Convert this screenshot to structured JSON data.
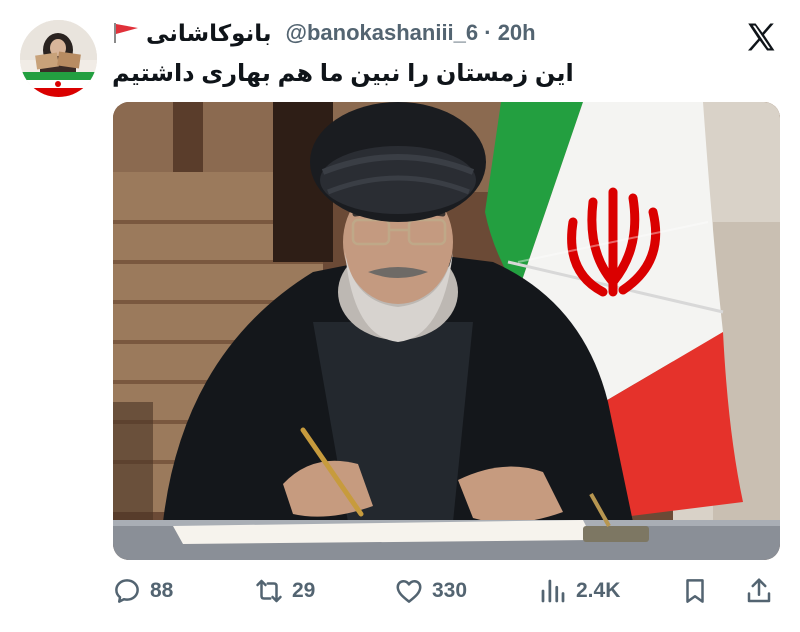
{
  "tweet": {
    "author": {
      "display_name": "بانوکاشانی",
      "handle_time": "@banokashaniii_6 · 20h",
      "avatar_icon": "avatar-with-iran-flag",
      "name_emoji": "iran-flag-emoji"
    },
    "text": "این زمستان را نبین ما هم بهاری داشتیم",
    "platform_icon": "x-logo-icon",
    "media": {
      "kind": "photo",
      "icon": "photo-cleric-signing-with-iran-flag"
    },
    "actions": {
      "replies": "88",
      "retweets": "29",
      "likes": "330",
      "views": "2.4K"
    }
  },
  "colors": {
    "text_primary": "#0f1419",
    "text_secondary": "#536471",
    "flag_green": "#239f40",
    "flag_red": "#da0000",
    "flag_white": "#ffffff"
  }
}
